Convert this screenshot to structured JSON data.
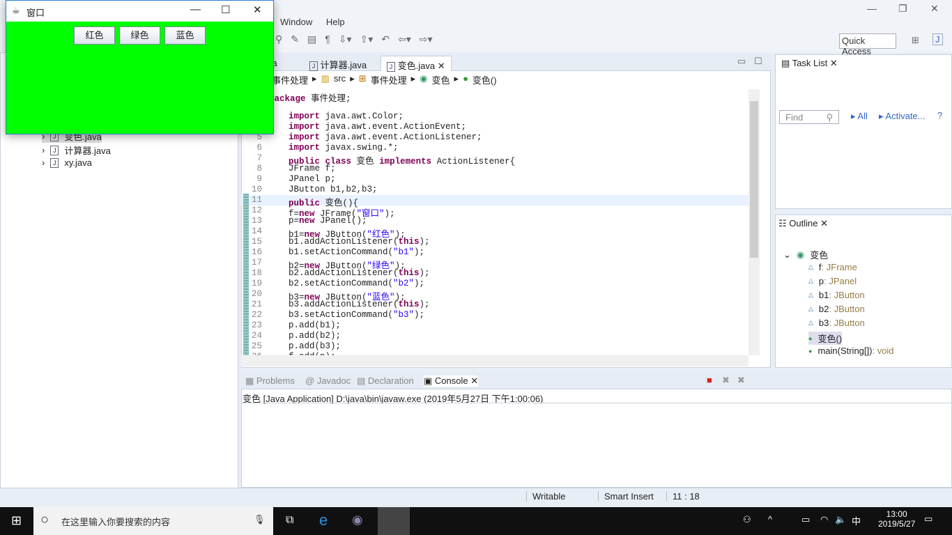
{
  "menu": {
    "items": [
      "Window",
      "Help"
    ]
  },
  "quick_access": "Quick Access",
  "package_explorer": {
    "items": [
      "变色.java",
      "计算器.java",
      "xy.java"
    ]
  },
  "editor": {
    "tabs": [
      "va",
      "计算器.java",
      "变色.java"
    ],
    "breadcrumb": [
      "事件处理",
      "src",
      "事件处理",
      "变色",
      "变色()"
    ],
    "current_line": 11,
    "lines": [
      "package 事件处理;",
      "",
      "import java.awt.Color;",
      "import java.awt.event.ActionEvent;",
      "import java.awt.event.ActionListener;",
      "import javax.swing.*;",
      "public class 变色 implements ActionListener{",
      "JFrame f;",
      "JPanel p;",
      "JButton b1,b2,b3;",
      "public 变色(){",
      "f=new JFrame(\"窗口\");",
      "p=new JPanel();",
      "b1=new JButton(\"红色\");",
      "b1.addActionListener(this);",
      "b1.setActionCommand(\"b1\");",
      "b2=new JButton(\"绿色\");",
      "b2.addActionListener(this);",
      "b2.setActionCommand(\"b2\");",
      "b3=new JButton(\"蓝色\");",
      "b3.addActionListener(this);",
      "b3.setActionCommand(\"b3\");",
      "p.add(b1);",
      "p.add(b2);",
      "p.add(b3);",
      "f.add(p);"
    ]
  },
  "task_list": {
    "title": "Task List",
    "find_placeholder": "Find",
    "all": "All",
    "activate": "Activate..."
  },
  "outline": {
    "title": "Outline",
    "class": "变色",
    "members": [
      {
        "name": "f",
        "type": " : JFrame"
      },
      {
        "name": "p",
        "type": " : JPanel"
      },
      {
        "name": "b1",
        "type": " : JButton"
      },
      {
        "name": "b2",
        "type": " : JButton"
      },
      {
        "name": "b3",
        "type": " : JButton"
      },
      {
        "name": "变色()",
        "type": ""
      },
      {
        "name": "main(String[])",
        "type": " : void"
      }
    ]
  },
  "console": {
    "tabs": [
      "Problems",
      "Javadoc",
      "Declaration",
      "Console"
    ],
    "launch": "变色 [Java Application] D:\\java\\bin\\javaw.exe (2019年5月27日 下午1:00:06)"
  },
  "status": {
    "writable": "Writable",
    "insert": "Smart Insert",
    "position": "11 : 18"
  },
  "taskbar": {
    "search": "在这里输入你要搜索的内容",
    "time": "13:00",
    "date": "2019/5/27",
    "ime": "中"
  },
  "java_window": {
    "title": "窗口",
    "buttons": [
      "红色",
      "绿色",
      "蓝色"
    ],
    "background": "#00ff00"
  }
}
